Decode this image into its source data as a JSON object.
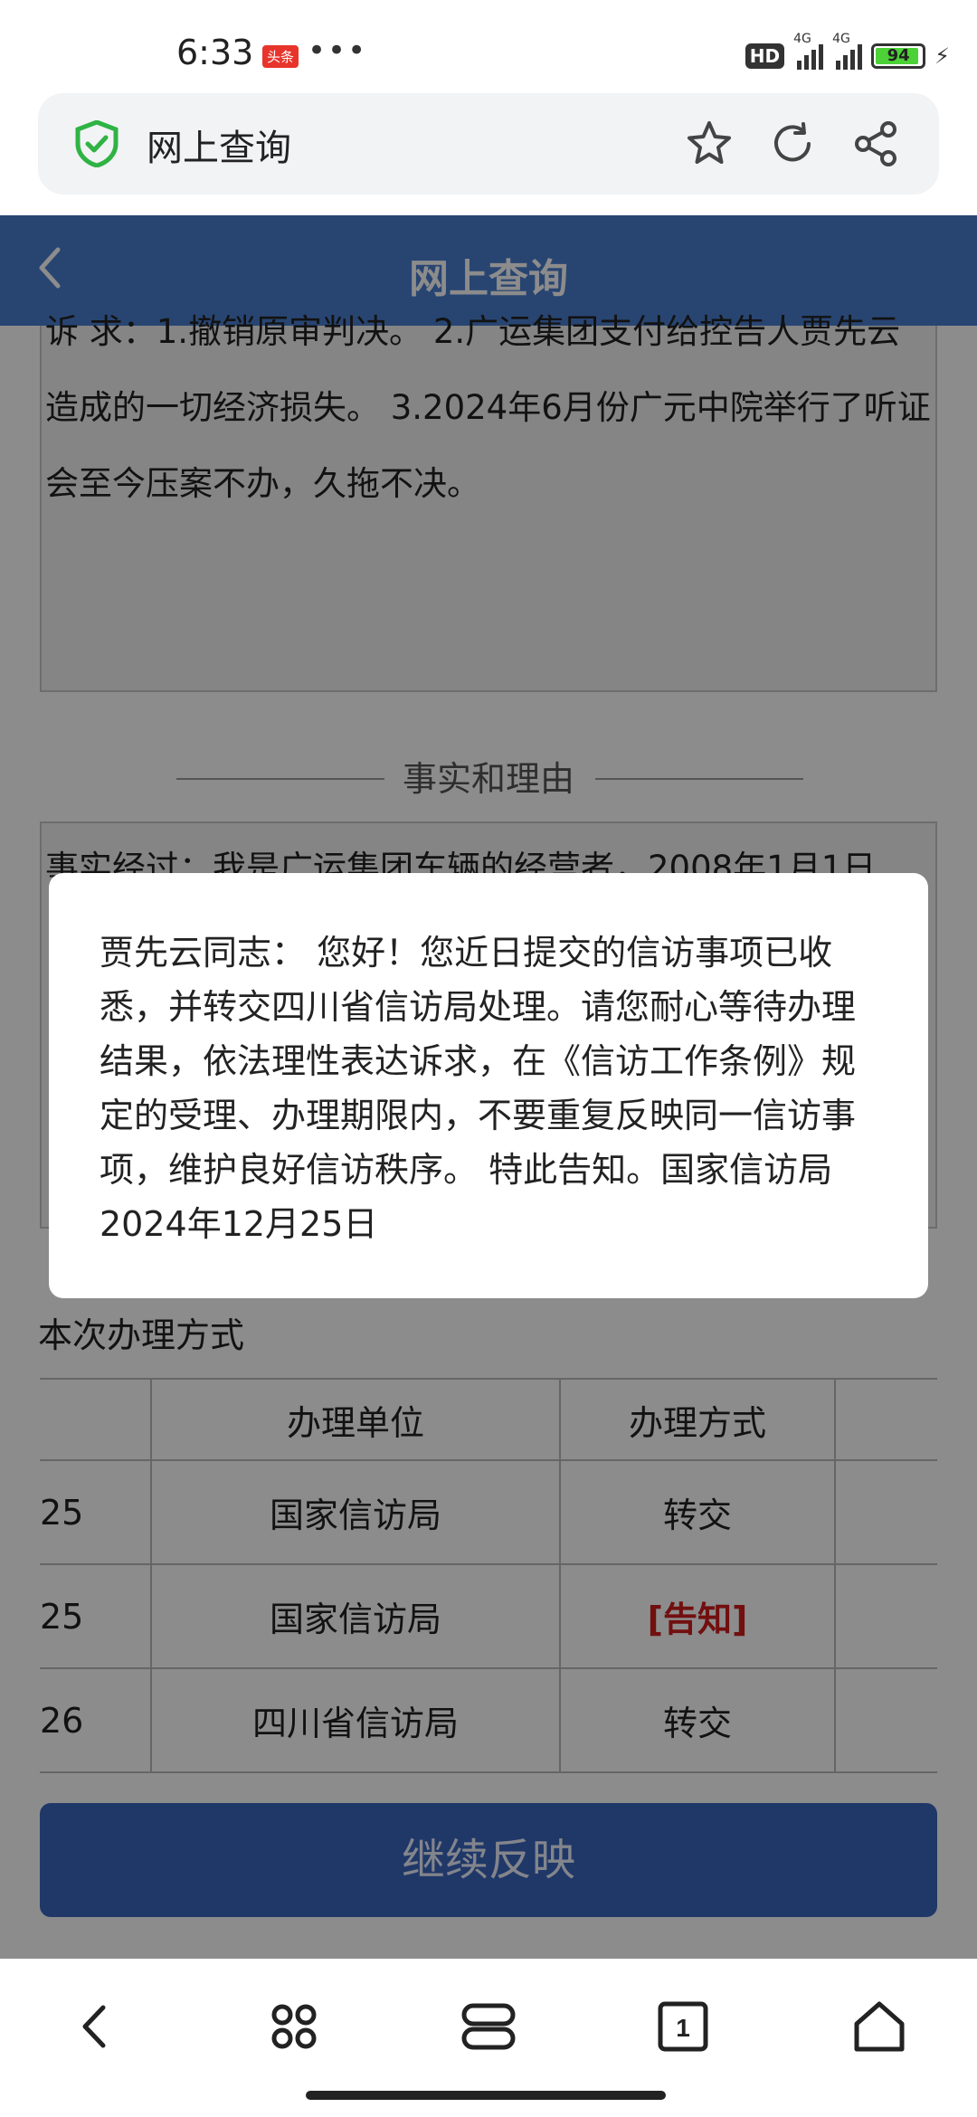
{
  "status_bar": {
    "time": "6:33",
    "app_badge": "头条",
    "more": "•••",
    "hd": "HD",
    "net1": "4G",
    "net2": "4G",
    "battery": "94",
    "battery_level": 0.94
  },
  "browser": {
    "title": "网上查询",
    "icons": [
      "shield-check-icon",
      "star-icon",
      "refresh-icon",
      "share-icon"
    ]
  },
  "header": {
    "title": "网上查询"
  },
  "request": {
    "text": "诉 求：1.撤销原审判决。 2.广运集团支付给控告人贾先云造成的一切经济损失。 3.2024年6月份广元中院举行了听证会至今压案不办，久拖不决。"
  },
  "facts": {
    "section_title": "事实和理由",
    "text": "事实经过：我是广运集团车辆的经营者，2008年1月1日"
  },
  "method": {
    "title": "本次办理方式",
    "headers": [
      "",
      "办理单位",
      "办理方式",
      ""
    ],
    "rows": [
      {
        "date": "25",
        "unit": "国家信访局",
        "method": "转交"
      },
      {
        "date": "25",
        "unit": "国家信访局",
        "method": "[告知]"
      },
      {
        "date": "26",
        "unit": "四川省信访局",
        "method": "转交"
      }
    ]
  },
  "continue_button": "继续反映",
  "modal": {
    "text": "贾先云同志： 您好！您近日提交的信访事项已收悉，并转交四川省信访局处理。请您耐心等待办理结果，依法理性表达诉求，在《信访工作条例》规定的受理、办理期限内，不要重复反映同一信访事项，维护良好信访秩序。 特此告知。国家信访局2024年12月25日"
  },
  "bottom_nav": {
    "icons": [
      "back-icon",
      "apps-icon",
      "menu-icon",
      "tabs-icon",
      "home-icon"
    ],
    "tab_count": "1"
  },
  "colors": {
    "header_blue": "#4a7fcf",
    "button_blue": "#3a67bd",
    "notice_red": "#d01c1c",
    "shield_green": "#2fb344"
  }
}
